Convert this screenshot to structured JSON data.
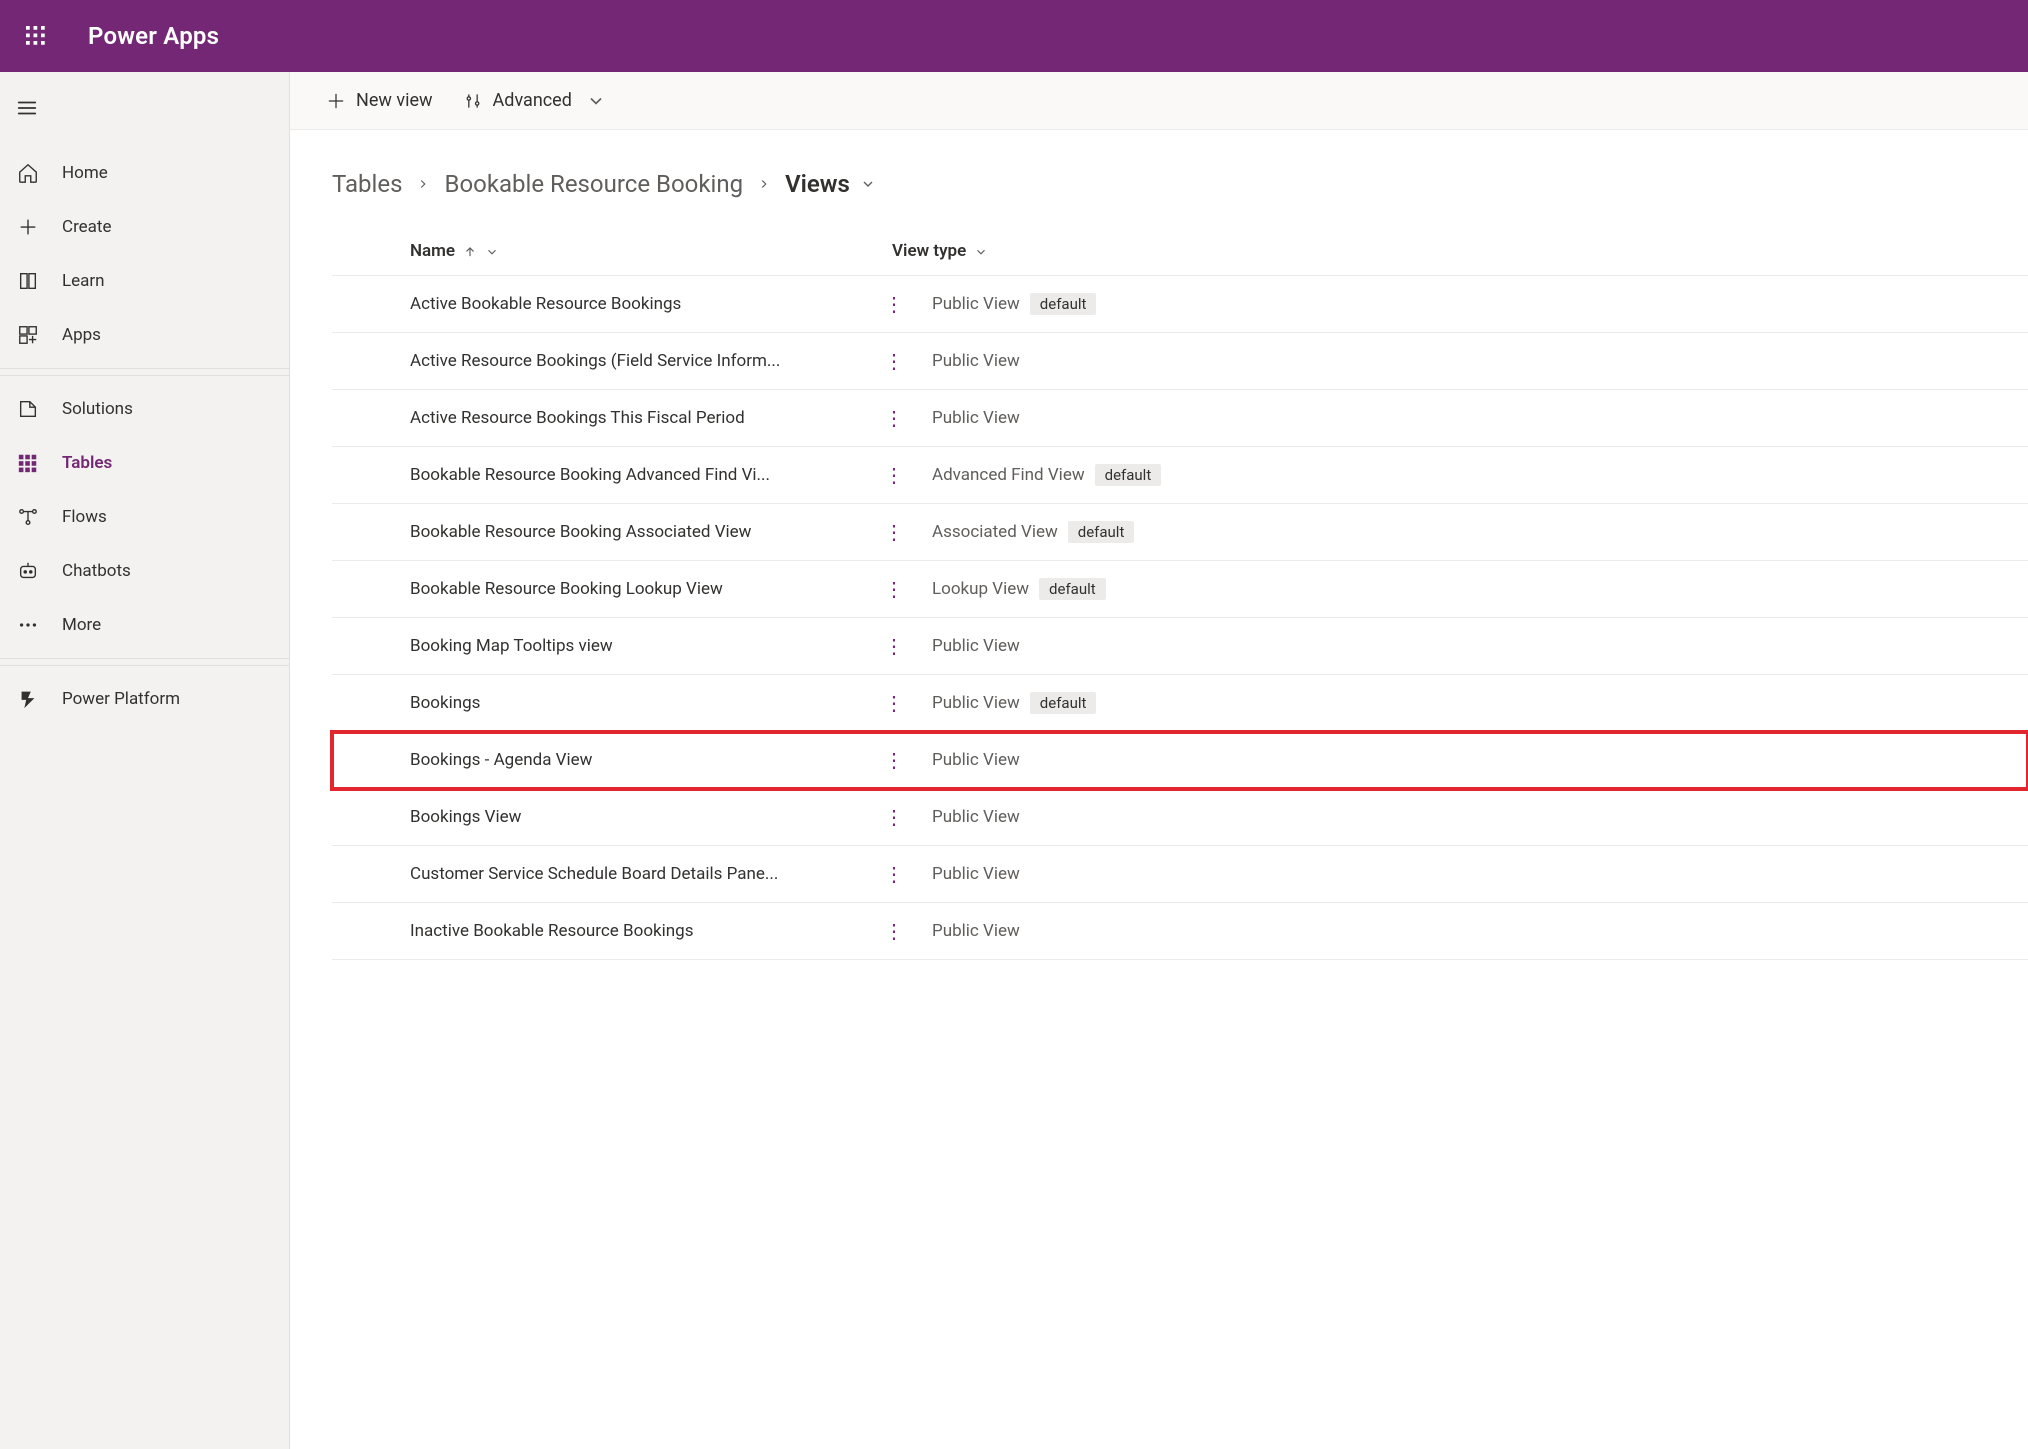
{
  "suite": {
    "title": "Power Apps"
  },
  "nav": {
    "top": [
      {
        "id": "home",
        "label": "Home"
      },
      {
        "id": "create",
        "label": "Create"
      },
      {
        "id": "learn",
        "label": "Learn"
      },
      {
        "id": "apps",
        "label": "Apps"
      }
    ],
    "mid": [
      {
        "id": "solutions",
        "label": "Solutions"
      },
      {
        "id": "tables",
        "label": "Tables",
        "selected": true
      },
      {
        "id": "flows",
        "label": "Flows"
      },
      {
        "id": "chatbots",
        "label": "Chatbots"
      },
      {
        "id": "more",
        "label": "More"
      }
    ],
    "bottom": [
      {
        "id": "power-platform",
        "label": "Power Platform"
      }
    ]
  },
  "commandbar": {
    "new_view": "New view",
    "advanced": "Advanced"
  },
  "breadcrumb": {
    "root": "Tables",
    "entity": "Bookable Resource Booking",
    "current": "Views"
  },
  "grid": {
    "columns": {
      "name": "Name",
      "viewtype": "View type"
    },
    "default_badge": "default",
    "rows": [
      {
        "name": "Active Bookable Resource Bookings",
        "viewtype": "Public View",
        "default": true
      },
      {
        "name": "Active Resource Bookings (Field Service Inform...",
        "viewtype": "Public View",
        "default": false
      },
      {
        "name": "Active Resource Bookings This Fiscal Period",
        "viewtype": "Public View",
        "default": false
      },
      {
        "name": "Bookable Resource Booking Advanced Find Vi...",
        "viewtype": "Advanced Find View",
        "default": true
      },
      {
        "name": "Bookable Resource Booking Associated View",
        "viewtype": "Associated View",
        "default": true
      },
      {
        "name": "Bookable Resource Booking Lookup View",
        "viewtype": "Lookup View",
        "default": true
      },
      {
        "name": "Booking Map Tooltips view",
        "viewtype": "Public View",
        "default": false
      },
      {
        "name": "Bookings",
        "viewtype": "Public View",
        "default": true
      },
      {
        "name": "Bookings - Agenda View",
        "viewtype": "Public View",
        "default": false,
        "highlight": true
      },
      {
        "name": "Bookings View",
        "viewtype": "Public View",
        "default": false
      },
      {
        "name": "Customer Service Schedule Board Details Pane...",
        "viewtype": "Public View",
        "default": false
      },
      {
        "name": "Inactive Bookable Resource Bookings",
        "viewtype": "Public View",
        "default": false
      }
    ]
  }
}
